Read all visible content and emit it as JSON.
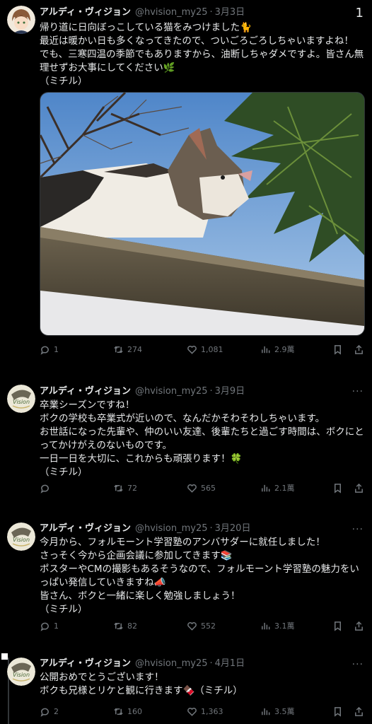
{
  "page_indicator": "1",
  "tweets": [
    {
      "name": "アルディ・ヴィジョン",
      "handle": "@hvision_my25",
      "date": "3月3日",
      "lines": [
        "帰り道に日向ぼっこしている猫をみつけました🐈",
        "最近は暖かい日も多くなってきたので、ついごろごろしちゃいますよね！",
        "でも、三寒四温の季節でもありますから、油断しちゃダメですよ。皆さん無",
        "理せずお大事にしてください🌿",
        "（ミチル）"
      ],
      "replies": "1",
      "retweets": "274",
      "likes": "1,081",
      "views": "2.9萬"
    },
    {
      "name": "アルディ・ヴィジョン",
      "handle": "@hvision_my25",
      "date": "3月9日",
      "lines": [
        "卒業シーズンですね！",
        "ボクの学校も卒業式が近いので、なんだかそわそわしちゃいます。",
        "お世話になった先輩や、仲のいい友達、後輩たちと過ごす時間は、ボクにと",
        "ってかけがえのないものです。",
        "一日一日を大切に、これからも頑張ります！🍀",
        "（ミチル）"
      ],
      "replies": "",
      "retweets": "72",
      "likes": "565",
      "views": "2.1萬"
    },
    {
      "name": "アルディ・ヴィジョン",
      "handle": "@hvision_my25",
      "date": "3月20日",
      "lines": [
        "今月から、フォルモーント学習塾のアンバサダーに就任しました！",
        "さっそく今から企画会議に参加してきます📚",
        "ポスターやCMの撮影もあるそうなので、フォルモーント学習塾の魅力をい",
        "っぱい発信していきますね📣",
        "皆さん、ボクと一緒に楽しく勉強しましょう！",
        "（ミチル）"
      ],
      "replies": "1",
      "retweets": "82",
      "likes": "552",
      "views": "3.1萬"
    },
    {
      "name": "アルディ・ヴィジョン",
      "handle": "@hvision_my25",
      "date": "4月1日",
      "lines": [
        "公開おめでとうございます！",
        "ボクも兄様とリケと観に行きます🍫（ミチル）"
      ],
      "replies": "2",
      "retweets": "160",
      "likes": "1,363",
      "views": "3.5萬"
    }
  ],
  "icons": {
    "reply": "reply-icon",
    "retweet": "retweet-icon",
    "like": "heart-icon",
    "views": "views-icon",
    "bookmark": "bookmark-icon",
    "share": "share-icon",
    "more": "more-icon"
  },
  "colors": {
    "background": "#000000",
    "text": "#e7e9ea",
    "muted": "#71767b"
  }
}
